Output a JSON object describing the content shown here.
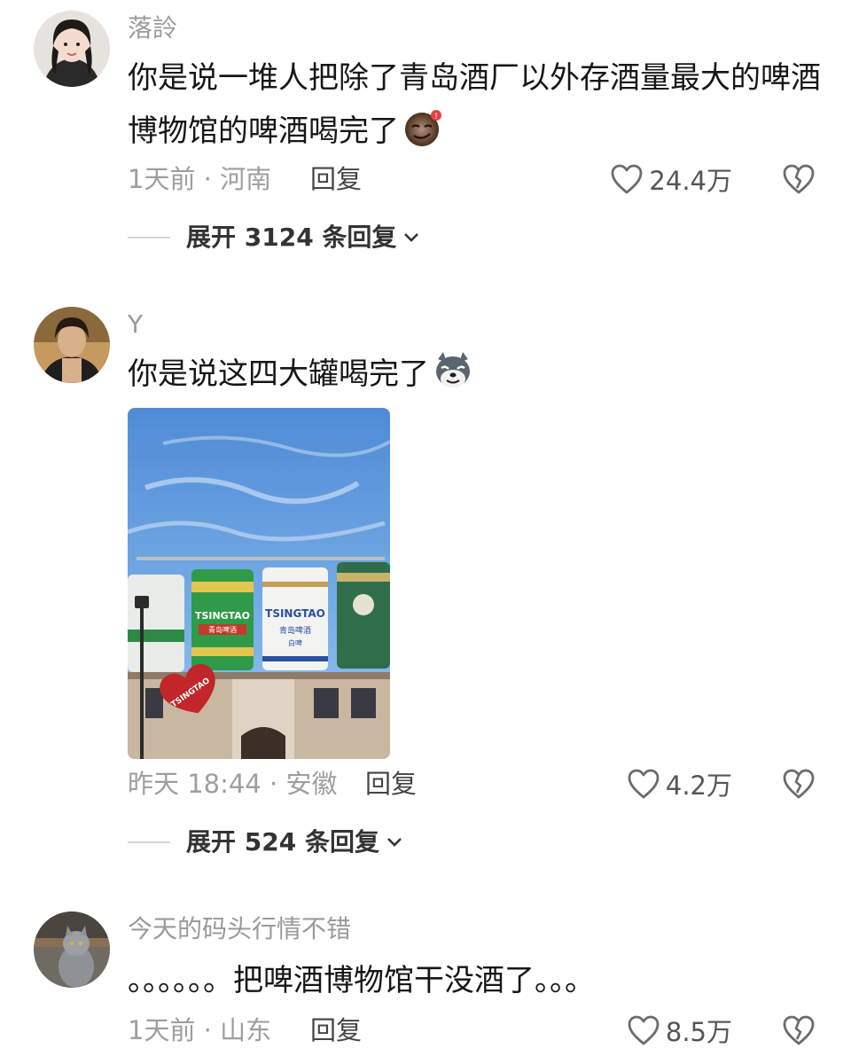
{
  "comments": [
    {
      "username": "落詅",
      "text": "你是说一堆人把除了青岛酒厂以外存酒量最大的啤酒博物馆的啤酒喝完了",
      "emoji": "sly-face-emoji",
      "meta": "1天前 · 河南",
      "reply_label": "回复",
      "likes": "24.4万",
      "expand_label": "展开 3124 条回复"
    },
    {
      "username": "Y",
      "text": "你是说这四大罐喝完了",
      "emoji": "husky-dog-emoji",
      "image": {
        "alt": "beer-tanks-photo",
        "labels": {
          "brand_can_1": "TSINGTAO",
          "brand_can_1_cn": "青岛啤酒",
          "brand_can_2": "TSINGTAO",
          "brand_can_2_cn": "青岛啤酒",
          "brand_can_2_sub": "白啤",
          "brand_heart": "TSINGTAO"
        }
      },
      "meta": "昨天 18:44 · 安徽",
      "reply_label": "回复",
      "likes": "4.2万",
      "expand_label": "展开 524 条回复"
    },
    {
      "username": "今天的码头行情不错",
      "text": "。。。。。。把啤酒博物馆干没酒了。。。",
      "meta": "1天前 · 山东",
      "reply_label": "回复",
      "likes": "8.5万"
    }
  ],
  "colors": {
    "username": "#9a9a9a",
    "text": "#161616",
    "meta": "#9e9e9e",
    "icon": "#6b6b6b",
    "sky": "#5f95d6"
  },
  "icons": {
    "like": "heart-outline-icon",
    "dislike": "broken-heart-icon",
    "expand": "chevron-down-icon"
  }
}
